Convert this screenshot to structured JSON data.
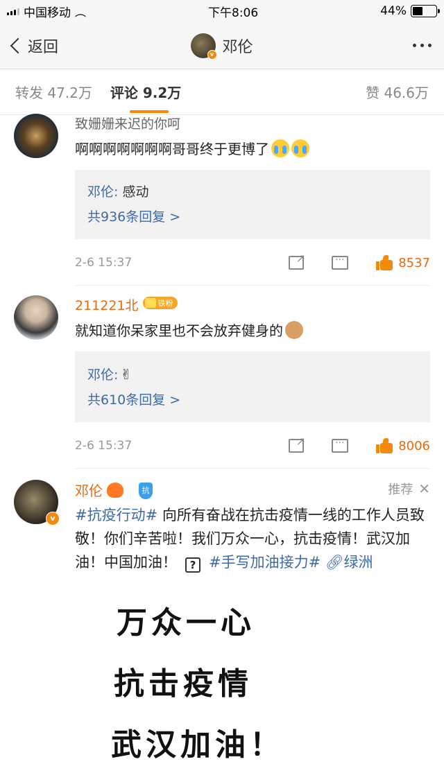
{
  "status": {
    "carrier": "中国移动",
    "time": "下午8:06",
    "battery": "44%",
    "battery_level": 0.44
  },
  "nav": {
    "back_label": "返回",
    "title": "邓伦"
  },
  "tabs": {
    "repost": "转发 47.2万",
    "comments": "评论 9.2万",
    "likes": "赞 46.6万"
  },
  "comments": [
    {
      "name": "致姗姗来迟的你呵",
      "text": "啊啊啊啊啊啊啊哥哥终于更博了",
      "reply_name": "邓伦:",
      "reply_text": " 感动",
      "reply_more": "共936条回复 >",
      "time": "2-6 15:37",
      "likes": "8537"
    },
    {
      "name": "211221北",
      "fan_badge": "铁粉",
      "text": "就知道你呆家里也不会放弃健身的",
      "reply_name": "邓伦:",
      "reply_text": "✌",
      "reply_more": "共610条回复 >",
      "time": "2-6 15:37",
      "likes": "8006"
    }
  ],
  "post": {
    "name": "邓伦",
    "recommend": "推荐",
    "shield_text": "抗",
    "hashtag1": "#抗疫行动#",
    "text": " 向所有奋战在抗击疫情一线的工作人员致敬！你们辛苦啦！我们万众一心，抗击疫情！武汉加油！中国加油！",
    "hashtag2": "#手写加油接力#",
    "link": "绿洲",
    "image_lines": [
      "万众一心",
      "抗击疫情",
      "武汉加油！"
    ]
  }
}
